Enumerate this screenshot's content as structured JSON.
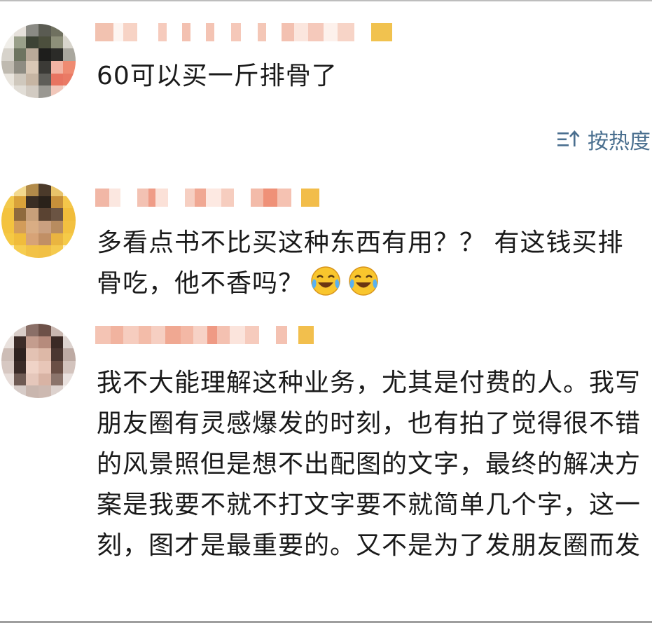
{
  "sort": {
    "label": "按热度",
    "icon": "sort-icon"
  },
  "comments": [
    {
      "text": "60可以买一斤排骨了"
    },
    {
      "text": "多看点书不比买这种东西有用？？ 有这钱买排骨吃，他不香吗？",
      "emojis": [
        "laughing-crying-emoji",
        "laughing-crying-emoji"
      ]
    },
    {
      "text": "我不大能理解这种业务，尤其是付费的人。我写朋友圈有灵感爆发的时刻，也有拍了觉得很不错的风景照但是想不出配图的文字，最终的解决方案是我要不就不打文字要不就简单几个字，这一刻，图才是最重要的。又不是为了发朋友圈而发"
    }
  ],
  "colors": {
    "sort_link": "#4a6f8f",
    "body_text": "#1a1a1a"
  }
}
